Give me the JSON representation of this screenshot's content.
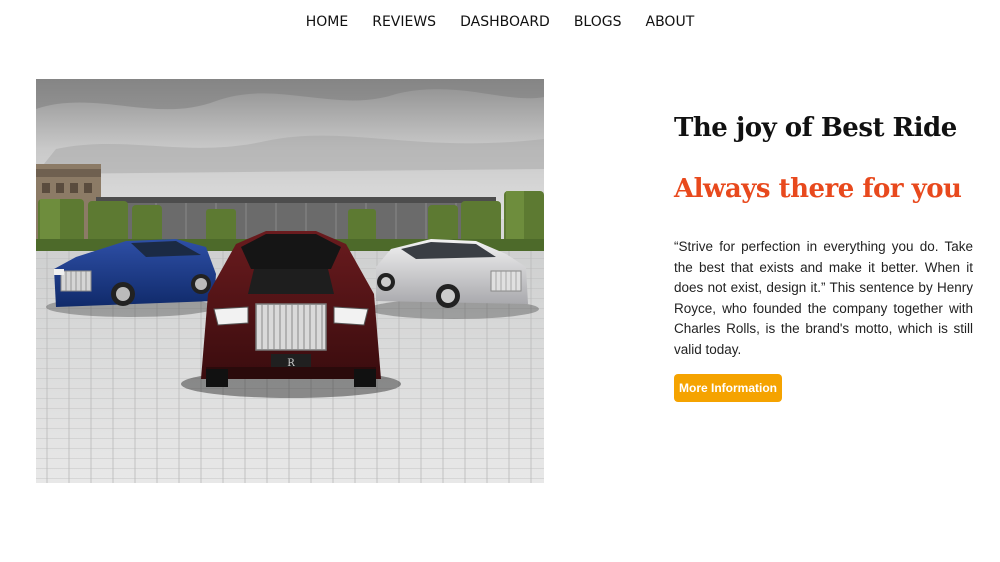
{
  "nav": {
    "items": [
      {
        "label": "HOME"
      },
      {
        "label": "REVIEWS"
      },
      {
        "label": "DASHBOARD"
      },
      {
        "label": "BLOGS"
      },
      {
        "label": "ABOUT"
      }
    ]
  },
  "hero": {
    "image": "three-rolls-royce-cars-photo",
    "grille_letter": "R"
  },
  "content": {
    "title": "The joy of Best Ride",
    "subtitle": "Always there for you",
    "quote": "“Strive for perfection in everything you do. Take the best that exists and make it better. When it does not exist, design it.” This sentence by Henry Royce, who founded the company together with Charles Rolls, is the brand's motto, which is still valid today.",
    "button_label": "More Information"
  },
  "colors": {
    "accent": "#e8491d",
    "button": "#f5a300",
    "text": "#111111"
  }
}
